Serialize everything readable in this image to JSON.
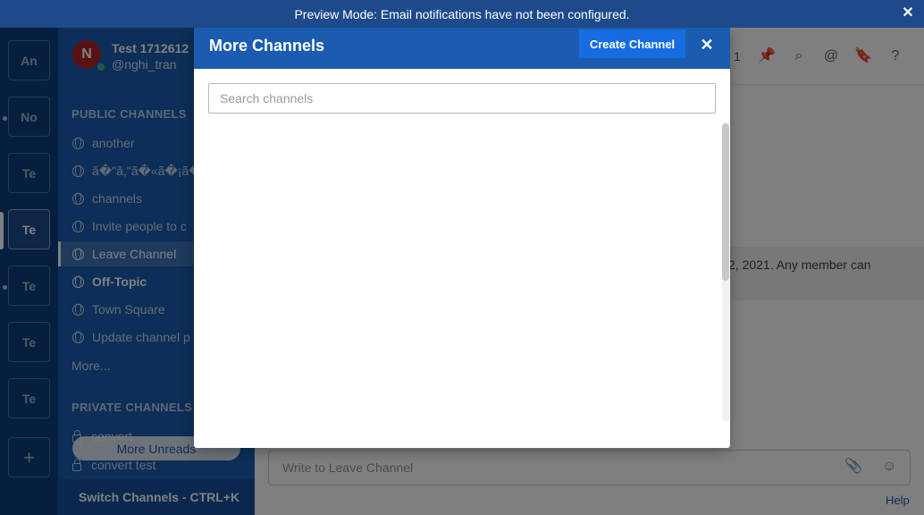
{
  "banner": {
    "text": "Preview Mode: Email notifications have not been configured.",
    "close_label": "✕"
  },
  "teams": [
    {
      "label": "An"
    },
    {
      "label": "No"
    },
    {
      "label": "Te"
    },
    {
      "label": "Te"
    },
    {
      "label": "Te"
    },
    {
      "label": "Te"
    },
    {
      "label": "Te"
    }
  ],
  "team_add_label": "+",
  "sidebar": {
    "team_name": "Test 1712612",
    "username": "@nghi_tran",
    "avatar_letter": "N",
    "public_title": "PUBLIC CHANNELS",
    "public_channels": [
      {
        "label": "another"
      },
      {
        "label": "ã�\"ã,\"ã�«ã�¡ã�"
      },
      {
        "label": "channels"
      },
      {
        "label": "Invite people to c"
      },
      {
        "label": "Leave Channel"
      },
      {
        "label": "Off-Topic"
      },
      {
        "label": "Town Square"
      },
      {
        "label": "Update channel p"
      }
    ],
    "more_label": "More...",
    "private_title": "PRIVATE CHANNELS",
    "private_channels": [
      {
        "label": "convert"
      },
      {
        "label": "convert test"
      }
    ],
    "more_unreads_label": "More Unreads",
    "switch_label": "Switch Channels - CTRL+K"
  },
  "main": {
    "member_count": "1",
    "intro_text": "2, 2021. Any member can",
    "post_placeholder": "Write to Leave Channel",
    "help_label": "Help"
  },
  "modal": {
    "title": "More Channels",
    "create_label": "Create Channel",
    "close_label": "✕",
    "search_placeholder": "Search channels"
  },
  "colors": {
    "brand": "#1b5cb0",
    "team_sidebar": "#0f3f7d",
    "banner": "#1e4a8c",
    "create_button": "#166de0"
  }
}
